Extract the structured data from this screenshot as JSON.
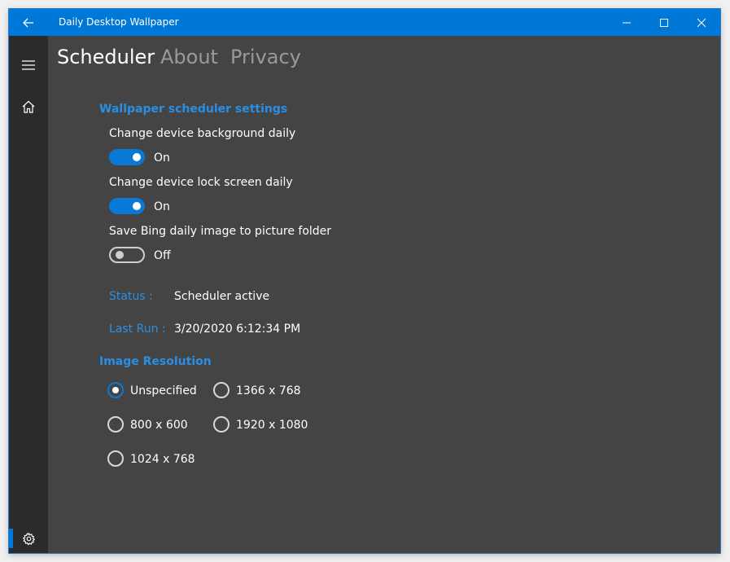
{
  "window": {
    "title": "Daily Desktop Wallpaper",
    "accent_color": "#0078d7"
  },
  "nav": {
    "items": [
      {
        "name": "menu",
        "icon": "hamburger-icon"
      },
      {
        "name": "home",
        "icon": "home-icon"
      },
      {
        "name": "settings",
        "icon": "gear-icon",
        "selected": true
      }
    ]
  },
  "tabs": [
    {
      "label": "Scheduler",
      "active": true
    },
    {
      "label": "About",
      "active": false
    },
    {
      "label": "Privacy",
      "active": false
    }
  ],
  "scheduler": {
    "section_title": "Wallpaper scheduler settings",
    "settings": [
      {
        "label": "Change device background daily",
        "state": "On",
        "on": true
      },
      {
        "label": "Change device lock screen daily",
        "state": "On",
        "on": true
      },
      {
        "label": "Save Bing daily image to picture folder",
        "state": "Off",
        "on": false
      }
    ],
    "status": {
      "key": "Status :",
      "value": "Scheduler active"
    },
    "last_run": {
      "key": "Last Run :",
      "value": "3/20/2020 6:12:34 PM"
    }
  },
  "resolution": {
    "section_title": "Image Resolution",
    "options": [
      {
        "label": "Unspecified",
        "checked": true
      },
      {
        "label": "1366 x 768",
        "checked": false
      },
      {
        "label": "800 x 600",
        "checked": false
      },
      {
        "label": "1920 x 1080",
        "checked": false
      },
      {
        "label": "1024 x 768",
        "checked": false
      }
    ]
  }
}
